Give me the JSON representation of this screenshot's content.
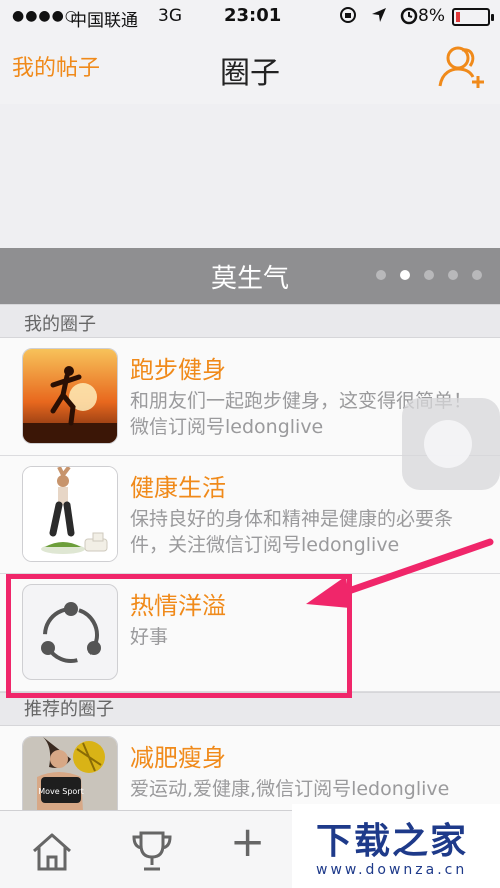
{
  "status_bar": {
    "signal": "●●●●○",
    "carrier": "中国联通",
    "network": "3G",
    "time": "23:01",
    "battery": "8%"
  },
  "nav": {
    "left_button": "我的帖子",
    "title": "圈子"
  },
  "banner": {
    "title": "莫生气",
    "page_count": 5,
    "active_page": 2
  },
  "sections": {
    "my_groups": "我的圈子",
    "recommended": "推荐的圈子"
  },
  "my_groups": [
    {
      "name": "跑步健身",
      "desc": "和朋友们一起跑步健身，这变得很简单！微信订阅号ledonglive"
    },
    {
      "name": "健康生活",
      "desc": "保持良好的身体和精神是健康的必要条件，关注微信订阅号ledonglive"
    },
    {
      "name": "热情洋溢",
      "desc": "好事"
    }
  ],
  "recommended_groups": [
    {
      "name": "减肥瘦身",
      "desc": "爱运动,爱健康,微信订阅号ledonglive"
    }
  ],
  "watermark": {
    "title": "下载之家",
    "url": "www.downza.cn"
  },
  "colors": {
    "accent": "#f08a1a",
    "highlight": "#f0266a",
    "banner_bg": "#8f8f91"
  }
}
